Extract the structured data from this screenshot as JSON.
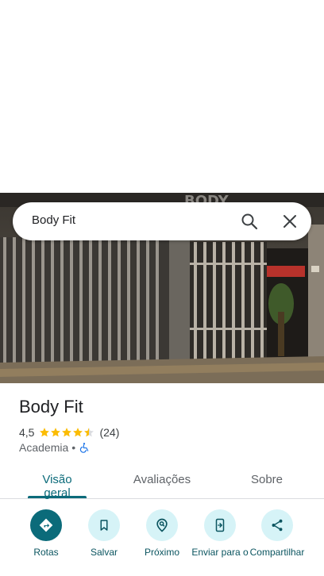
{
  "search": {
    "query": "Body Fit"
  },
  "hero": {
    "sign_text": "BODY"
  },
  "place": {
    "title": "Body Fit",
    "rating": "4,5",
    "review_count": "(24)",
    "category": "Academia",
    "separator": "•"
  },
  "tabs": [
    {
      "label": "Visão geral"
    },
    {
      "label": "Avaliações"
    },
    {
      "label": "Sobre"
    }
  ],
  "actions": [
    {
      "label": "Rotas"
    },
    {
      "label": "Salvar"
    },
    {
      "label": "Próximo"
    },
    {
      "label": "Enviar para o"
    },
    {
      "label": "Compartilhar"
    }
  ],
  "colors": {
    "accent": "#0b6b7a",
    "chip": "#d6f3f7",
    "star": "#fbbc04"
  }
}
